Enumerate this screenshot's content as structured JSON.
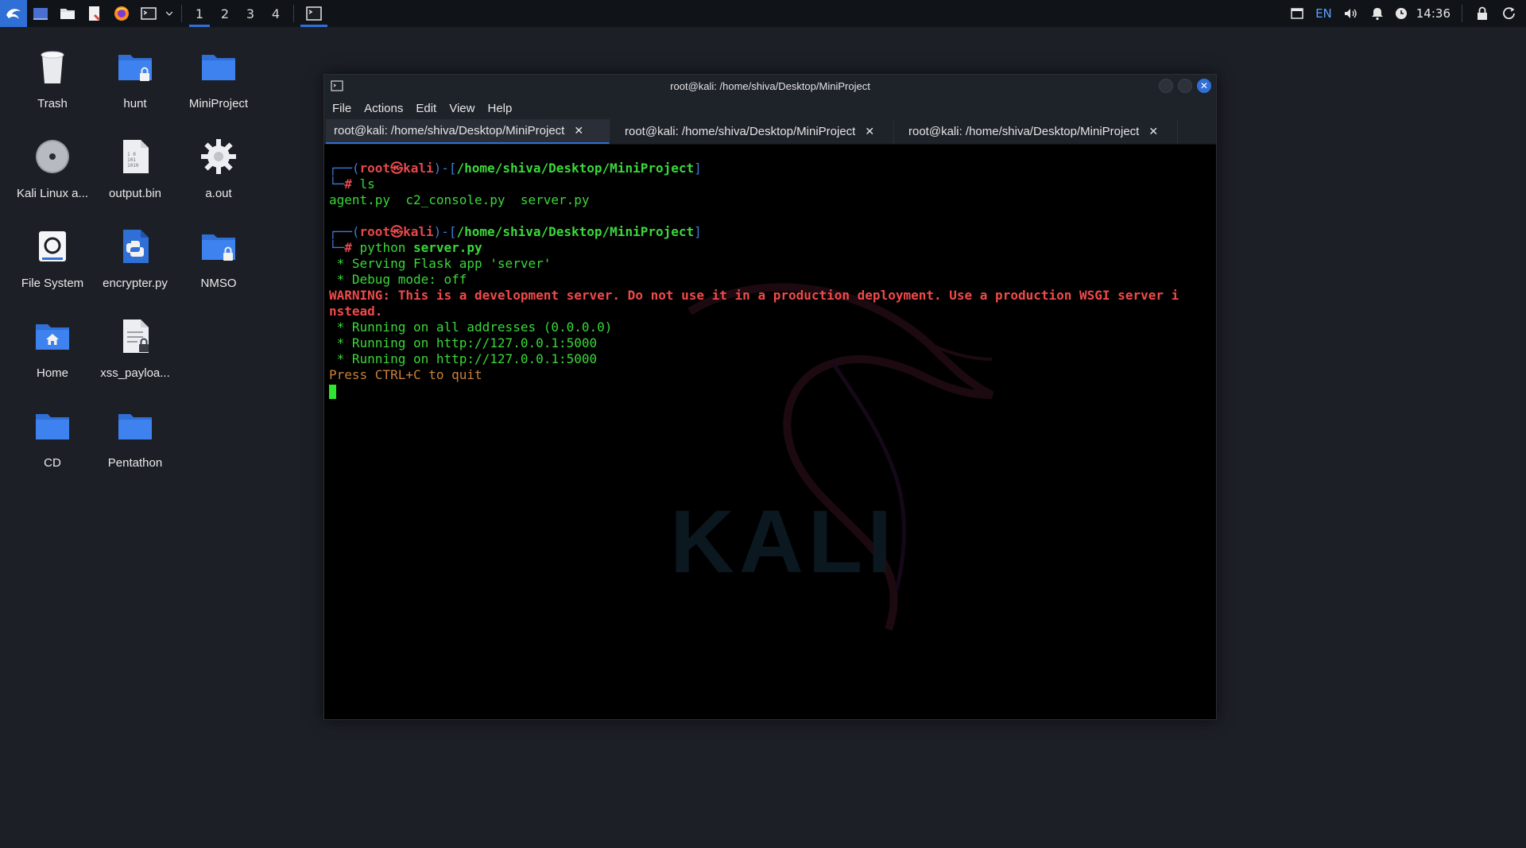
{
  "panel": {
    "workspaces": [
      "1",
      "2",
      "3",
      "4"
    ],
    "active_workspace": "1",
    "tray": {
      "language": "EN",
      "time": "14:36"
    },
    "icons": [
      "kali-menu-icon",
      "show-desktop-icon",
      "file-manager-icon",
      "text-editor-icon",
      "firefox-icon",
      "terminal-icon",
      "chevron-down-icon"
    ]
  },
  "desktop": {
    "icons": [
      {
        "label": "Trash",
        "icon": "trash-icon"
      },
      {
        "label": "hunt",
        "icon": "folder-locked-icon"
      },
      {
        "label": "MiniProject",
        "icon": "folder-icon"
      },
      {
        "label": "Kali Linux a...",
        "icon": "disc-icon"
      },
      {
        "label": "output.bin",
        "icon": "binary-file-icon"
      },
      {
        "label": "a.out",
        "icon": "gear-icon"
      },
      {
        "label": "File System",
        "icon": "drive-icon"
      },
      {
        "label": "encrypter.py",
        "icon": "python-file-icon"
      },
      {
        "label": "NMSO",
        "icon": "folder-locked-icon"
      },
      {
        "label": "Home",
        "icon": "home-folder-icon"
      },
      {
        "label": "xss_payloa...",
        "icon": "file-locked-icon"
      },
      {
        "label": "CD",
        "icon": "folder-icon"
      },
      {
        "label": "Pentathon",
        "icon": "folder-icon"
      }
    ]
  },
  "terminal": {
    "title": "root@kali: /home/shiva/Desktop/MiniProject",
    "menu": [
      "File",
      "Actions",
      "Edit",
      "View",
      "Help"
    ],
    "tabs": [
      {
        "label": "root@kali: /home/shiva/Desktop/MiniProject",
        "close": "✕"
      },
      {
        "label": "root@kali: /home/shiva/Desktop/MiniProject",
        "close": "✕"
      },
      {
        "label": "root@kali: /home/shiva/Desktop/MiniProject",
        "close": "✕"
      }
    ],
    "watermark": "KALI",
    "prompt": {
      "user": "root",
      "at": "㉿",
      "host": "kali",
      "path": "/home/shiva/Desktop/MiniProject",
      "hash": "#"
    },
    "session": {
      "cmd1": "ls",
      "ls_output": "agent.py  c2_console.py  server.py",
      "cmd2_prog": "python",
      "cmd2_arg": "server.py",
      "out1": " * Serving Flask app 'server'",
      "out2": " * Debug mode: off",
      "warn1": "WARNING: This is a development server. Do not use it in a production deployment. Use a production WSGI server i",
      "warn2": "nstead.",
      "out3": " * Running on all addresses (0.0.0.0)",
      "out4": " * Running on http://127.0.0.1:5000",
      "out5": " * Running on http://127.0.0.1:5000",
      "quit": "Press CTRL+C to quit"
    }
  }
}
